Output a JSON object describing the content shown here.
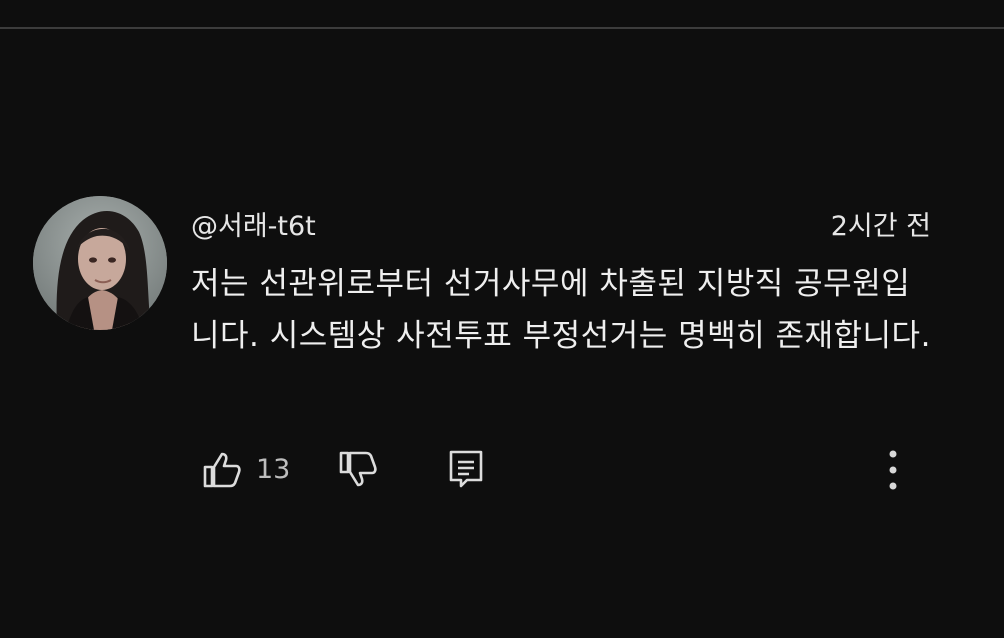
{
  "comment": {
    "author": "@서래-t6t",
    "timestamp": "2시간 전",
    "text": "저는 선관위로부터 선거사무에 차출된 지방직 공무원입니다. 시스템상 사전투표 부정선거는 명백히 존재합니다."
  },
  "actions": {
    "like_count": "13",
    "icons": {
      "like": "thumbs-up-icon",
      "dislike": "thumbs-down-icon",
      "reply": "reply-comment-icon",
      "more": "more-vertical-icon"
    }
  },
  "colors": {
    "background": "#0e0e0e",
    "text": "#efefef",
    "secondary_text": "#bdbdbd",
    "divider": "#3c3c3c"
  }
}
